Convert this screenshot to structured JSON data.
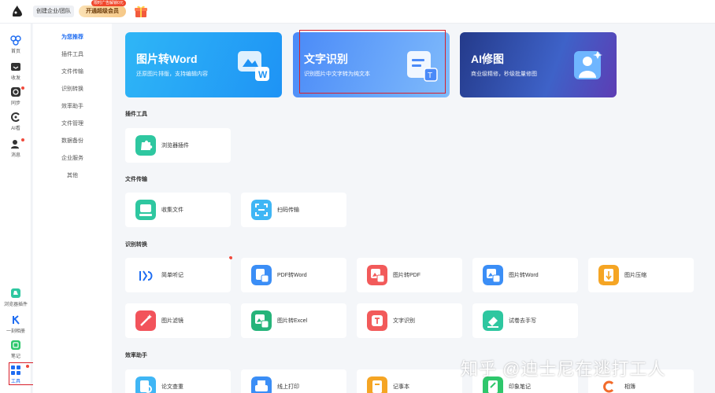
{
  "topbar": {
    "team_label": "创建企业/团队",
    "vip_label": "开通超级会员",
    "vip_badge": "限时广告解锁0元"
  },
  "rail": {
    "items": [
      {
        "label": "首页",
        "icon": "home-icon"
      },
      {
        "label": "收发",
        "icon": "inbox-icon"
      },
      {
        "label": "同步",
        "icon": "sync-icon"
      },
      {
        "label": "AI看",
        "icon": "ai-icon"
      },
      {
        "label": "消息",
        "icon": "message-icon"
      },
      {
        "label": "浏览器插件",
        "icon": "plugin-icon"
      },
      {
        "label": "一刻相册",
        "icon": "album-icon"
      },
      {
        "label": "笔记",
        "icon": "note-icon"
      },
      {
        "label": "工具",
        "icon": "tools-icon"
      }
    ]
  },
  "menu": {
    "items": [
      "为您推荐",
      "插件工具",
      "文件传输",
      "识别转换",
      "效率助手",
      "文件管理",
      "数据备份",
      "企业服务",
      "其他"
    ]
  },
  "hero": {
    "cards": [
      {
        "title": "图片转Word",
        "subtitle": "还原图片排版，支持编辑内容"
      },
      {
        "title": "文字识别",
        "subtitle": "识别图片中文字转为纯文本"
      },
      {
        "title": "AI修图",
        "subtitle": "商业级精修，秒级批量修图"
      }
    ]
  },
  "sections": {
    "plugin": "插件工具",
    "transfer": "文件传输",
    "convert": "识别转换",
    "efficiency": "效率助手"
  },
  "tools": {
    "plugin": [
      "浏览器插件"
    ],
    "transfer": [
      "收集文件",
      "扫码传输"
    ],
    "convert_row1": [
      "简单听记",
      "PDF转Word",
      "图片转PDF",
      "图片转Word",
      "图片压缩"
    ],
    "convert_row2": [
      "图片滤镜",
      "图片转Excel",
      "文字识别",
      "试卷去手写"
    ],
    "efficiency": [
      "论文查重",
      "线上打印",
      "记事本",
      "印象笔记",
      "相簿"
    ]
  },
  "watermark": "知乎 @迪士尼在逃打工人",
  "colors": {
    "accent": "#1e6cf1",
    "highlight_box": "#d81f2a"
  }
}
